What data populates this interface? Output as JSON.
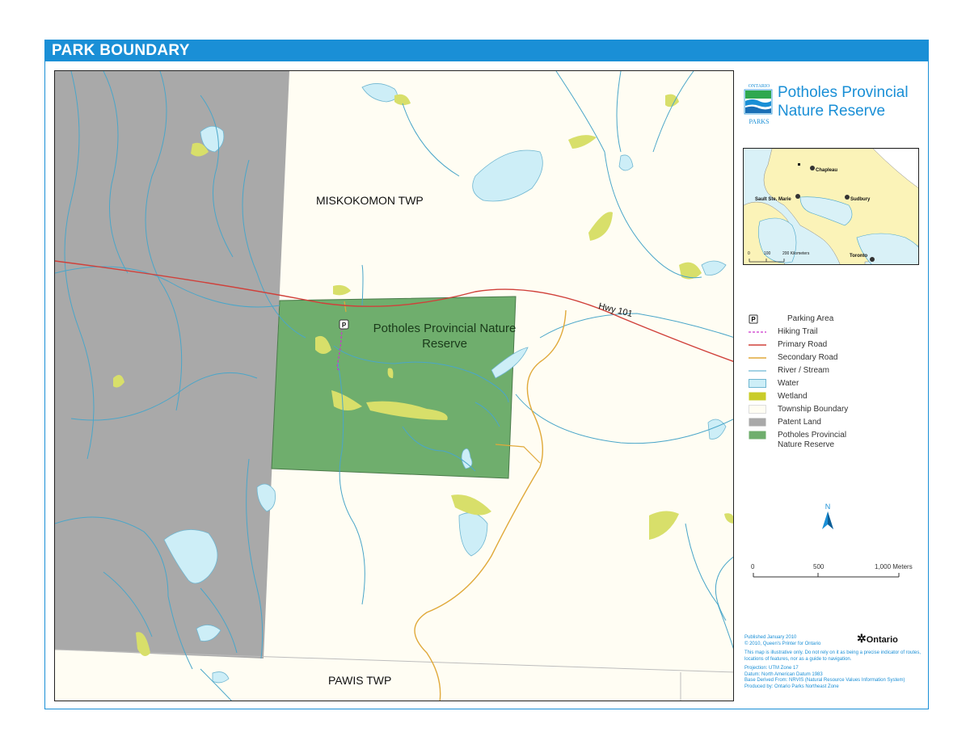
{
  "header": {
    "title": "PARK BOUNDARY"
  },
  "map": {
    "labels": {
      "north_township": "MISKOKOMON TWP",
      "south_township": "PAWIS TWP",
      "park": "Potholes Provincial Nature Reserve",
      "highway": "Hwy 101",
      "parking_symbol": "P"
    }
  },
  "brand": {
    "logo_top": "ONTARIO",
    "logo_bottom": "PARKS",
    "park_title": "Potholes Provincial\nNature Reserve"
  },
  "inset": {
    "cities": [
      "Chapleau",
      "Sault Ste. Marie",
      "Sudbury",
      "Toronto"
    ],
    "scale_ticks": [
      "0",
      "100",
      "200 Kilometers"
    ]
  },
  "legend": [
    {
      "label": "Parking Area",
      "symbol": "parking"
    },
    {
      "label": "Hiking Trail",
      "symbol": "hiking-trail"
    },
    {
      "label": "Primary Road",
      "symbol": "primary-road"
    },
    {
      "label": "Secondary Road",
      "symbol": "secondary-road"
    },
    {
      "label": "River / Stream",
      "symbol": "river"
    },
    {
      "label": "Water",
      "symbol": "water"
    },
    {
      "label": "Wetland",
      "symbol": "wetland"
    },
    {
      "label": "Township Boundary",
      "symbol": "township"
    },
    {
      "label": "Patent Land",
      "symbol": "patent-land"
    },
    {
      "label": "Potholes Provincial Nature Reserve",
      "symbol": "reserve"
    }
  ],
  "north_arrow": {
    "label": "N"
  },
  "scale_bar": {
    "ticks": [
      "0",
      "500",
      "1,000 Meters"
    ]
  },
  "credits": {
    "published": "Published January 2010",
    "copyright": "© 2010, Queen's Printer for Ontario",
    "disclaimer": "This map is illustrative only. Do not rely on it as being a precise indicator of routes, locations of features, nor as a guide to navigation.",
    "projection": "Projection: UTM Zone 17",
    "datum": "Datum: North American Datum 1983",
    "base": "Base Derived From: NRVIS (Natural Resource Values Information System)",
    "produced": "Produced by: Ontario Parks Northeast Zone",
    "ontario": "Ontario"
  },
  "colors": {
    "accent": "#1a8fd6",
    "water": "#cdeef7",
    "river": "#4aa6c9",
    "wetland": "#d8df6a",
    "patent_land": "#a9a9a9",
    "reserve": "#6fae6d",
    "primary_road": "#d0403a",
    "secondary_road": "#e0a93a",
    "trail": "#cc33cc",
    "township": "#fffdf3"
  }
}
